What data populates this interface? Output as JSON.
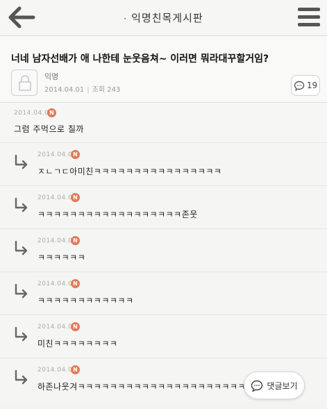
{
  "header": {
    "board_title": "익명친목게시판",
    "title_dot": "·"
  },
  "post": {
    "title": "너네 남자선배가 애 나한테 눈웃음쳐~ 이러면 뭐라대꾸할거임?",
    "author": "익명",
    "date": "2014.04.01",
    "views_label": "조회 243",
    "comment_count": "19"
  },
  "comments": [
    {
      "date": "2014.04.01",
      "badge": "N",
      "text": "그럼 주먹으로 칠까",
      "is_reply": false
    },
    {
      "date": "2014.04.01",
      "badge": "N",
      "text": "ㅈㄴㄱㄷ아미친ㅋㅋㅋㅋㅋㅋㅋㅋㅋㅋㅋㅋㅋㅋㅋㅋ",
      "is_reply": true
    },
    {
      "date": "2014.04.01",
      "badge": "N",
      "text": "ㅋㅋㅋㅋㅋㅋㅋㅋㅋㅋㅋㅋㅋㅋㅋㅋㅋㅋ존웃",
      "is_reply": true
    },
    {
      "date": "2014.04.01",
      "badge": "N",
      "text": "ㅋㅋㅋㅋㅋㅋ",
      "is_reply": true
    },
    {
      "date": "2014.04.01",
      "badge": "N",
      "text": "ㅋㅋㅋㅋㅋㅋㅋㅋㅋㅋㅋㅋ",
      "is_reply": true
    },
    {
      "date": "2014.04.01",
      "badge": "N",
      "text": "미친ㅋㅋㅋㅋㅋㅋㅋㅋ",
      "is_reply": true
    },
    {
      "date": "2014.04.01",
      "badge": "N",
      "text": "하존나웃겨ㅋㅋㅋㅋㅋㅋㅋㅋㅋㅋㅋㅋㅋㅋㅋㅋㅋㅋㅋㅋㅋㅋ",
      "is_reply": true
    }
  ],
  "view_comments_label": "댓글보기",
  "colors": {
    "badge": "#e07a5a",
    "background": "#f3f3f1"
  },
  "icons": {
    "back": "back-arrow-icon",
    "menu": "hamburger-menu-icon",
    "avatar": "lock-avatar-icon",
    "comment": "speech-bubble-icon",
    "reply": "reply-arrow-icon"
  }
}
